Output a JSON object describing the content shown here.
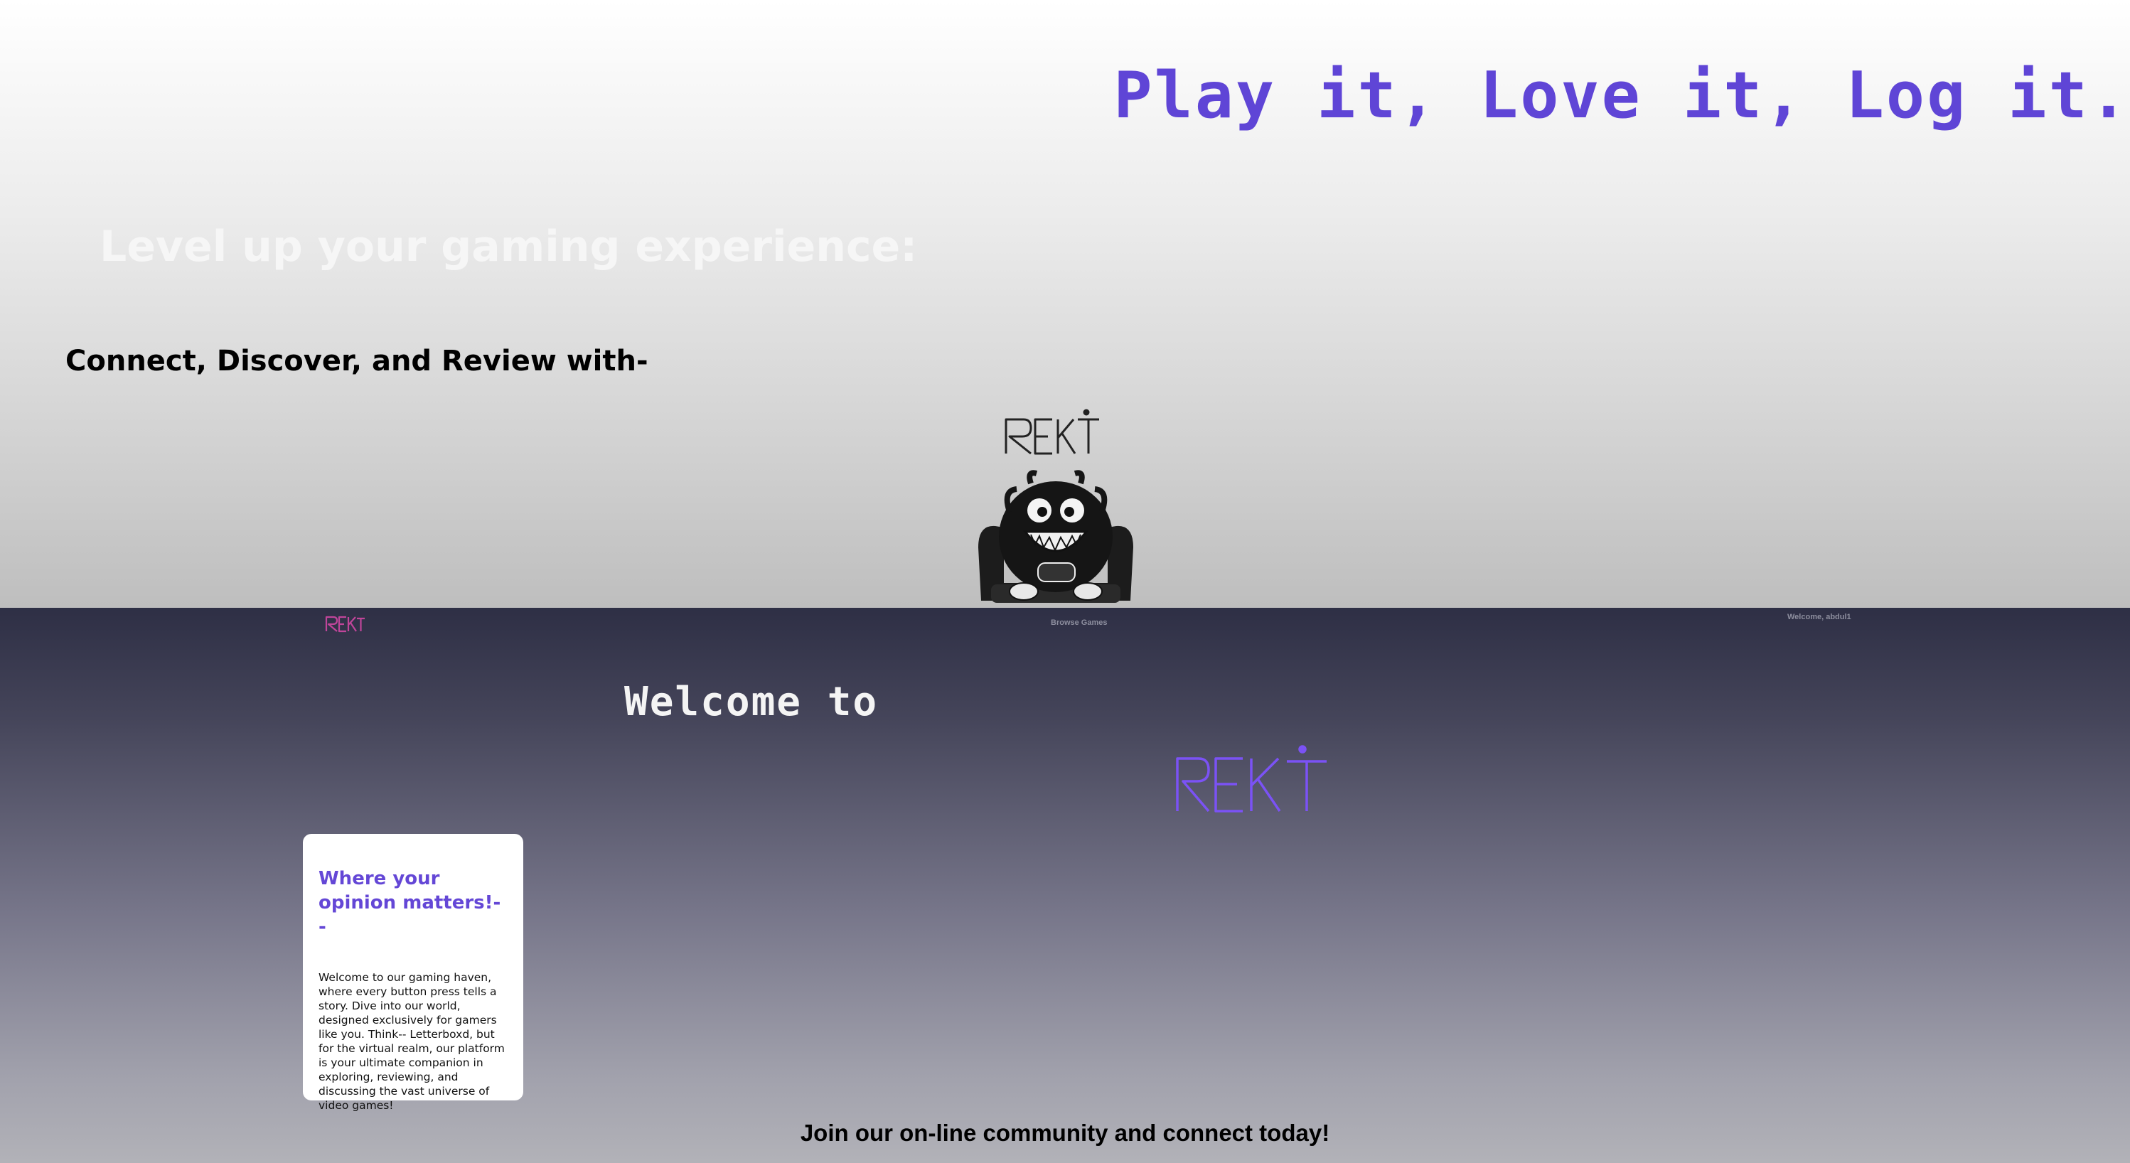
{
  "hero": {
    "tagline": "Play it, Love it, Log it.",
    "level_up": "Level up your gaming experience:",
    "connect": "Connect, Discover, and Review with-",
    "mascot_logo_text": "REKT",
    "mascot_icon": "monster-gamer-in-armchair-icon"
  },
  "nav": {
    "logo_text": "REKT",
    "browse_label": "Browse Games",
    "welcome_user": "Welcome, abdul1"
  },
  "main": {
    "welcome_heading": "Welcome to",
    "brand_logo_text": "REKT",
    "card": {
      "title": "Where your opinion matters!--",
      "body": "Welcome to our gaming haven, where every button press tells a story. Dive into our world, designed exclusively for gamers like you. Think-- Letterboxd, but for the virtual realm, our platform is your ultimate companion in exploring, reviewing, and discussing the vast universe of video games!"
    },
    "join_text": "Join our on-line community and connect today!"
  },
  "colors": {
    "accent": "#5f45d6",
    "nav_logo": "#c0459a",
    "neon_logo": "#7b52f5",
    "dark_band": "#2e2f45"
  }
}
